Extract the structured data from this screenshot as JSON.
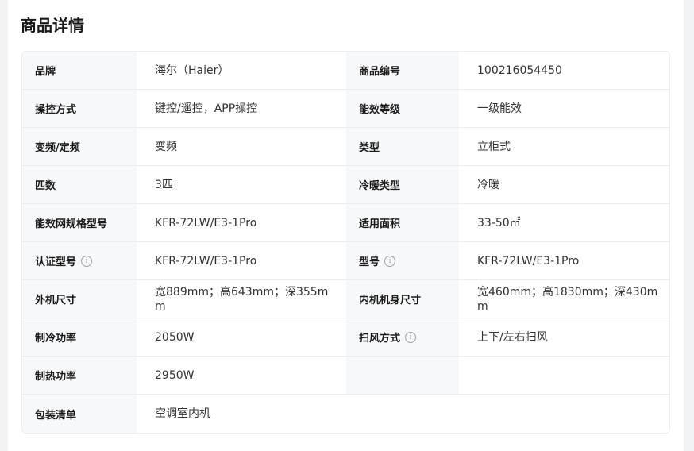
{
  "section_title": "商品详情",
  "specs": [
    {
      "l1": "品牌",
      "v1": "海尔（Haier）",
      "l2": "商品编号",
      "v2": "100216054450"
    },
    {
      "l1": "操控方式",
      "v1": "键控/遥控，APP操控",
      "l2": "能效等级",
      "v2": "一级能效"
    },
    {
      "l1": "变频/定频",
      "v1": "变频",
      "l2": "类型",
      "v2": "立柜式"
    },
    {
      "l1": "匹数",
      "v1": "3匹",
      "l2": "冷暖类型",
      "v2": "冷暖"
    },
    {
      "l1": "能效网规格型号",
      "v1": "KFR-72LW/E3-1Pro",
      "l2": "适用面积",
      "v2": "33-50㎡"
    },
    {
      "l1": "认证型号",
      "v1": "KFR-72LW/E3-1Pro",
      "l2": "型号",
      "v2": "KFR-72LW/E3-1Pro"
    },
    {
      "l1": "外机尺寸",
      "v1": "宽889mm；高643mm；深355mm",
      "l2": "内机机身尺寸",
      "v2": "宽460mm；高1830mm；深430mm"
    },
    {
      "l1": "制冷功率",
      "v1": "2050W",
      "l2": "扫风方式",
      "v2": "上下/左右扫风"
    },
    {
      "l1": "制热功率",
      "v1": "2950W"
    },
    {
      "l1": "包装清单",
      "v1": "空调室内机"
    }
  ],
  "info_icon_glyph": "i"
}
